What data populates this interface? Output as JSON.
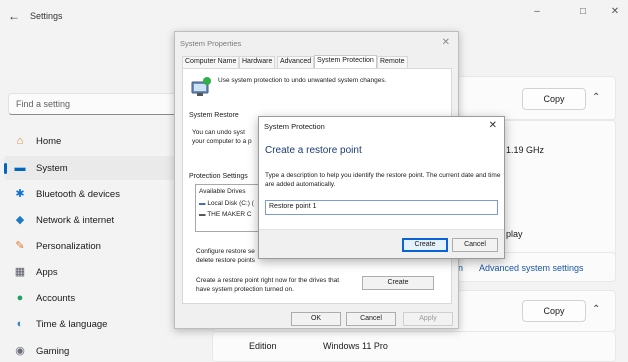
{
  "app": {
    "back": "←",
    "title": "Settings",
    "controls": {
      "minimize": "–",
      "maximize": "□",
      "close": "✕"
    }
  },
  "search": {
    "placeholder": "Find a setting",
    "icon": "search-icon"
  },
  "nav": [
    {
      "label": "Home",
      "icon": "home-icon",
      "glyph": "⌂",
      "color": "#d8842c"
    },
    {
      "label": "System",
      "icon": "system-icon",
      "glyph": "▬",
      "color": "#0067c0",
      "active": true
    },
    {
      "label": "Bluetooth & devices",
      "icon": "bluetooth-icon",
      "glyph": "✱",
      "color": "#0a74d6"
    },
    {
      "label": "Network & internet",
      "icon": "wifi-icon",
      "glyph": "◆",
      "color": "#1d7ac9"
    },
    {
      "label": "Personalization",
      "icon": "brush-icon",
      "glyph": "✎",
      "color": "#e07a2f"
    },
    {
      "label": "Apps",
      "icon": "apps-icon",
      "glyph": "▦",
      "color": "#555a66"
    },
    {
      "label": "Accounts",
      "icon": "accounts-icon",
      "glyph": "●",
      "color": "#22a06b"
    },
    {
      "label": "Time & language",
      "icon": "globe-icon",
      "glyph": "◐",
      "color": "#2a83c8"
    },
    {
      "label": "Gaming",
      "icon": "gaming-icon",
      "glyph": "◉",
      "color": "#6b6f78"
    }
  ],
  "right": {
    "copy": "Copy",
    "cpu_fragment": "1.19 GHz",
    "play_fragment": "play",
    "n_fragment": "n",
    "advanced_link": "Advanced system settings",
    "edition_label": "Edition",
    "edition_value": "Windows 11 Pro"
  },
  "system_properties": {
    "title": "System Properties",
    "tabs": [
      "Computer Name",
      "Hardware",
      "Advanced",
      "System Protection",
      "Remote"
    ],
    "selected_tab": 3,
    "intro": "Use system protection to undo unwanted system changes.",
    "restore_group": "System Restore",
    "restore_text_1": "You can undo syst",
    "restore_text_2": "your computer to a p",
    "protection_group": "Protection Settings",
    "drives_header": "Available Drives",
    "drive_1": "Local Disk (C:) (",
    "drive_2": "THE MAKER C",
    "configure_1": "Configure restore se",
    "configure_2": "delete restore points",
    "create_text_1": "Create a restore point right now for the drives that",
    "create_text_2": "have system protection turned on.",
    "create_button": "Create",
    "ok": "OK",
    "cancel": "Cancel",
    "apply": "Apply"
  },
  "protection_dialog": {
    "title": "System Protection",
    "heading": "Create a restore point",
    "description": "Type a description to help you identify the restore point. The current date and time are added automatically.",
    "input_value": "Restore point 1",
    "create": "Create",
    "cancel": "Cancel"
  }
}
